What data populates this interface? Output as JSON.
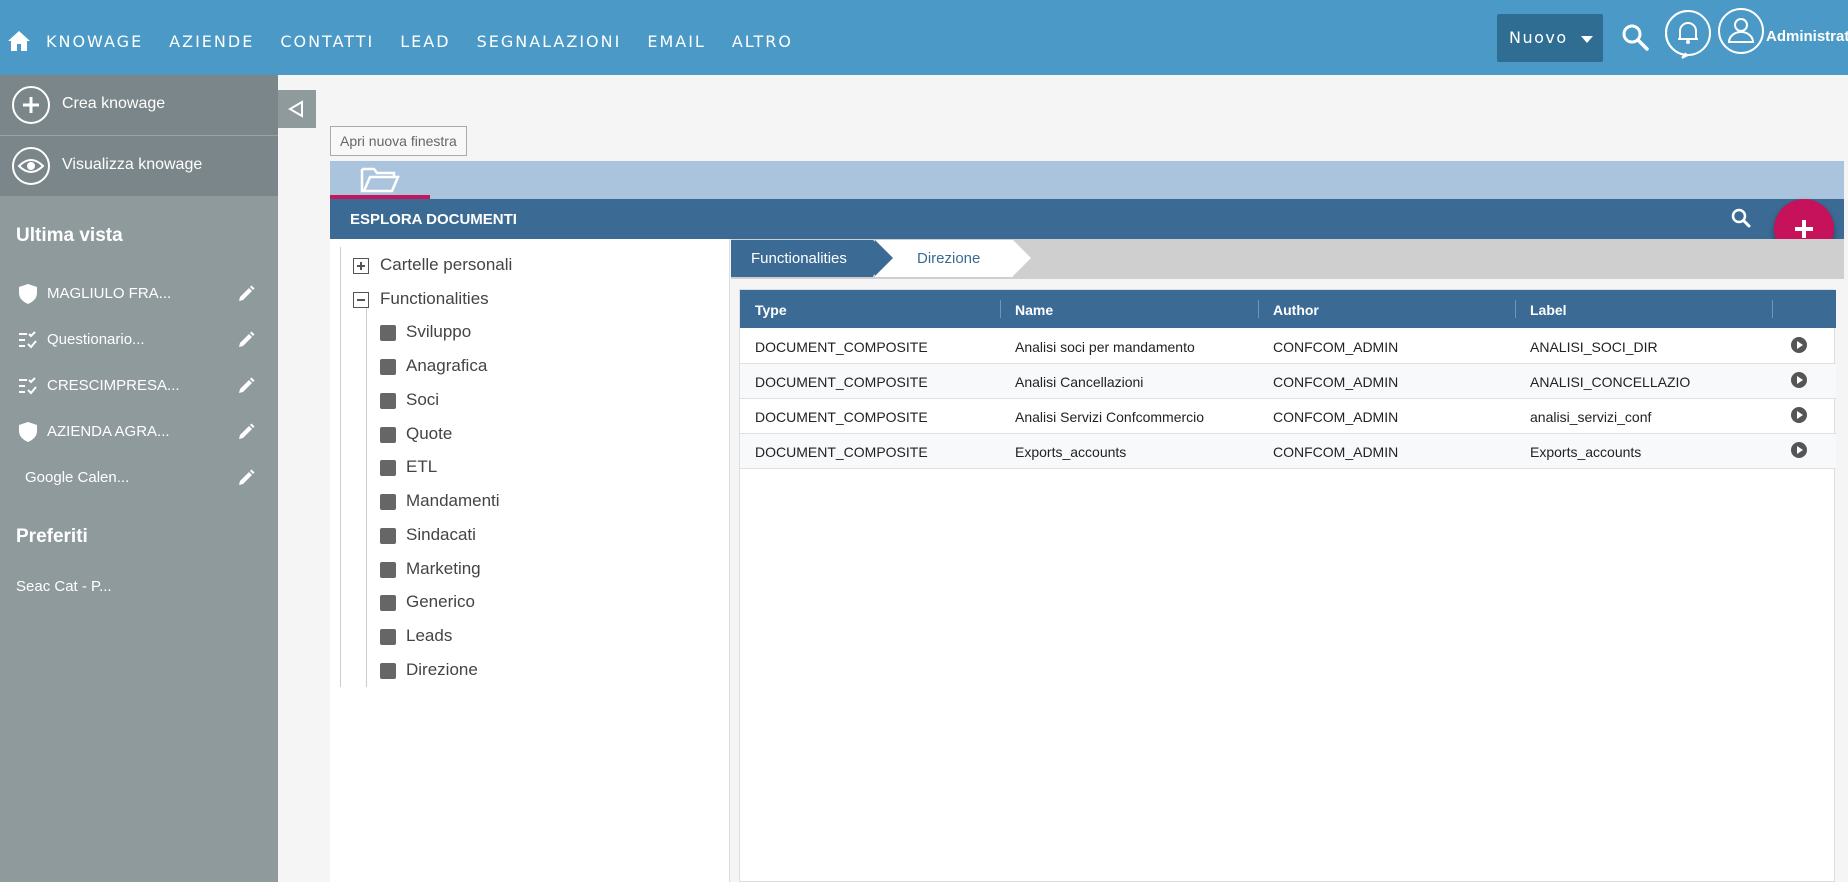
{
  "topbar": {
    "brand": "KNOWAGE",
    "nav": [
      "AZIENDE",
      "CONTATTI",
      "LEAD",
      "SEGNALAZIONI",
      "EMAIL",
      "ALTRO"
    ],
    "new_button": "Nuovo",
    "user_name": "Administrat",
    "color": "#4a99c6"
  },
  "sidebar": {
    "actions": [
      {
        "label": "Crea knowage",
        "icon": "plus-circle-icon"
      },
      {
        "label": "Visualizza knowage",
        "icon": "eye-icon"
      }
    ],
    "recent_title": "Ultima vista",
    "recent": [
      {
        "label": "MAGLIULO FRA...",
        "icon": "shield-icon"
      },
      {
        "label": "Questionario...",
        "icon": "checklist-icon"
      },
      {
        "label": "CRESCIMPRESA...",
        "icon": "checklist-icon"
      },
      {
        "label": "AZIENDA AGRA...",
        "icon": "shield-icon"
      },
      {
        "label": "Google Calen...",
        "icon": ""
      }
    ],
    "favorites_title": "Preferiti",
    "favorites": [
      {
        "label": "Seac Cat - P..."
      }
    ]
  },
  "main": {
    "open_window": "Apri nuova finestra",
    "panel_title": "ESPLORA DOCUMENTI",
    "tree": {
      "roots": [
        {
          "label": "Cartelle personali",
          "expanded": false
        },
        {
          "label": "Functionalities",
          "expanded": true
        }
      ],
      "children": [
        "Sviluppo",
        "Anagrafica",
        "Soci",
        "Quote",
        "ETL",
        "Mandamenti",
        "Sindacati",
        "Marketing",
        "Generico",
        "Leads",
        "Direzione"
      ]
    },
    "breadcrumb": [
      "Functionalities",
      "Direzione"
    ],
    "table": {
      "columns": [
        "Type",
        "Name",
        "Author",
        "Label"
      ],
      "rows": [
        {
          "type": "DOCUMENT_COMPOSITE",
          "name": "Analisi soci per mandamento",
          "author": "CONFCOM_ADMIN",
          "label": "ANALISI_SOCI_DIR"
        },
        {
          "type": "DOCUMENT_COMPOSITE",
          "name": "Analisi Cancellazioni",
          "author": "CONFCOM_ADMIN",
          "label": "ANALISI_CONCELLAZIO"
        },
        {
          "type": "DOCUMENT_COMPOSITE",
          "name": "Analisi Servizi Confcommercio",
          "author": "CONFCOM_ADMIN",
          "label": "analisi_servizi_conf"
        },
        {
          "type": "DOCUMENT_COMPOSITE",
          "name": "Exports_accounts",
          "author": "CONFCOM_ADMIN",
          "label": "Exports_accounts"
        }
      ]
    },
    "accent_color": "#c5125a",
    "header_color": "#3b6b94"
  }
}
